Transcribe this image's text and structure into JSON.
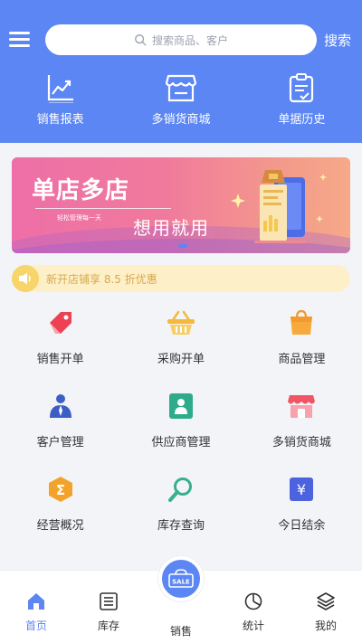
{
  "header": {
    "search_placeholder": "搜索商品、客户",
    "search_button": "搜索",
    "quick_links": [
      {
        "label": "销售报表",
        "icon": "sales-report-chart-icon"
      },
      {
        "label": "多销货商城",
        "icon": "store-icon"
      },
      {
        "label": "单据历史",
        "icon": "clipboard-history-icon"
      }
    ]
  },
  "banner": {
    "title": "单店多店",
    "small_text": "轻松管理每一天",
    "subtitle": "想用就用",
    "page_index": 1
  },
  "notice": {
    "text": "新开店铺享 8.5 折优惠",
    "icon": "speaker-icon"
  },
  "grid": {
    "items": [
      {
        "label": "销售开单",
        "icon": "tag-icon"
      },
      {
        "label": "采购开单",
        "icon": "basket-icon"
      },
      {
        "label": "商品管理",
        "icon": "shopping-bag-icon"
      },
      {
        "label": "客户管理",
        "icon": "customer-icon"
      },
      {
        "label": "供应商管理",
        "icon": "supplier-icon"
      },
      {
        "label": "多销货商城",
        "icon": "store-icon"
      },
      {
        "label": "经营概况",
        "icon": "sigma-icon"
      },
      {
        "label": "库存查询",
        "icon": "magnifier-icon"
      },
      {
        "label": "今日结余",
        "icon": "yen-icon"
      }
    ]
  },
  "tabbar": {
    "tabs": [
      {
        "label": "首页",
        "icon": "home-icon",
        "active": true
      },
      {
        "label": "库存",
        "icon": "inventory-list-icon",
        "active": false
      },
      {
        "label": "销售",
        "icon": "sale-badge-icon",
        "active": false
      },
      {
        "label": "统计",
        "icon": "pie-chart-icon",
        "active": false
      },
      {
        "label": "我的",
        "icon": "layers-icon",
        "active": false
      }
    ],
    "sale_badge_text": "SALE"
  },
  "colors": {
    "primary": "#5b86f3",
    "notice_bg": "#fdf0c9",
    "notice_text": "#d9a84a"
  }
}
